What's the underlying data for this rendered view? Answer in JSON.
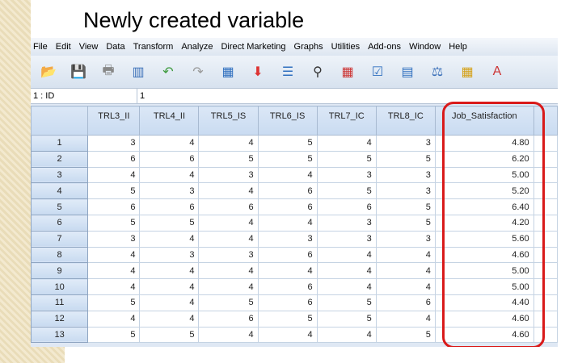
{
  "title": "Newly created variable",
  "menu": [
    "File",
    "Edit",
    "View",
    "Data",
    "Transform",
    "Analyze",
    "Direct Marketing",
    "Graphs",
    "Utilities",
    "Add-ons",
    "Window",
    "Help"
  ],
  "toolbar": [
    "open-folder",
    "save",
    "print",
    "recall-dialog",
    "undo",
    "redo",
    "goto-case",
    "insert-cases",
    "insert-variable",
    "find",
    "split-file",
    "select-cases",
    "weight-cases",
    "value-labels",
    "use-sets",
    "variable-labels"
  ],
  "cell_ref": {
    "name": "1 : ID",
    "value": "1"
  },
  "columns": [
    "TRL3_II",
    "TRL4_II",
    "TRL5_IS",
    "TRL6_IS",
    "TRL7_IC",
    "TRL8_IC",
    "Job_Satisfaction"
  ],
  "rows": [
    [
      "1",
      "3",
      "4",
      "4",
      "5",
      "4",
      "3",
      "4.80"
    ],
    [
      "2",
      "6",
      "6",
      "5",
      "5",
      "5",
      "5",
      "6.20"
    ],
    [
      "3",
      "4",
      "4",
      "3",
      "4",
      "3",
      "3",
      "5.00"
    ],
    [
      "4",
      "5",
      "3",
      "4",
      "6",
      "5",
      "3",
      "5.20"
    ],
    [
      "5",
      "6",
      "6",
      "6",
      "6",
      "6",
      "5",
      "6.40"
    ],
    [
      "6",
      "5",
      "5",
      "4",
      "4",
      "3",
      "5",
      "4.20"
    ],
    [
      "7",
      "3",
      "4",
      "4",
      "3",
      "3",
      "3",
      "5.60"
    ],
    [
      "8",
      "4",
      "3",
      "3",
      "6",
      "4",
      "4",
      "4.60"
    ],
    [
      "9",
      "4",
      "4",
      "4",
      "4",
      "4",
      "4",
      "5.00"
    ],
    [
      "10",
      "4",
      "4",
      "4",
      "6",
      "4",
      "4",
      "5.00"
    ],
    [
      "11",
      "5",
      "4",
      "5",
      "6",
      "5",
      "6",
      "4.40"
    ],
    [
      "12",
      "4",
      "4",
      "6",
      "5",
      "5",
      "4",
      "4.60"
    ],
    [
      "13",
      "5",
      "5",
      "4",
      "4",
      "4",
      "5",
      "4.60"
    ]
  ],
  "highlight_color": "#d91a1a"
}
